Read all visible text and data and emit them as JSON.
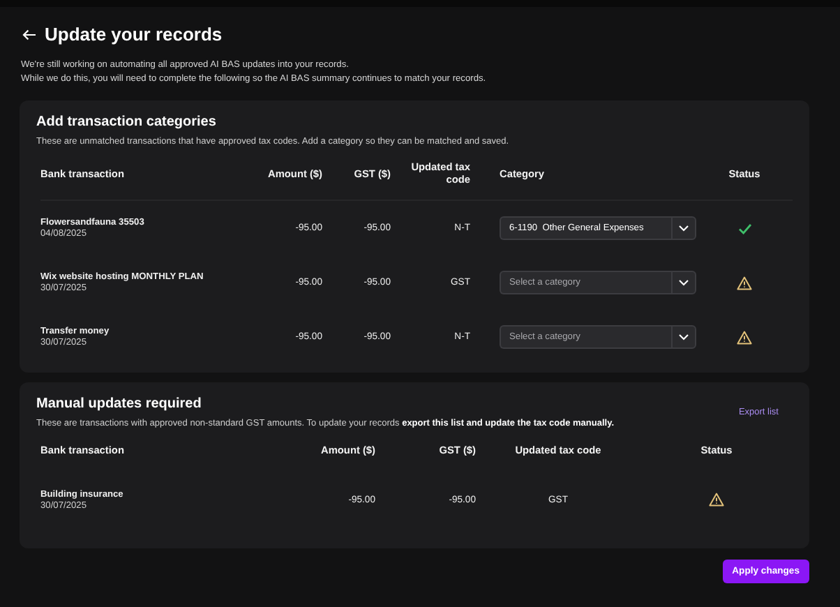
{
  "header": {
    "title": "Update your records",
    "intro": [
      "We're still working on automating all approved AI BAS updates into your records.",
      "While we do this, you will need to complete the following so the AI BAS summary continues to match your records."
    ]
  },
  "categories_section": {
    "title": "Add transaction categories",
    "description": "These are unmatched transactions that have approved tax codes. Add a category so they can be matched and saved.",
    "columns": [
      "Bank transaction",
      "Amount ($)",
      "GST ($)",
      "Updated tax code",
      "Category",
      "Status"
    ],
    "rows": [
      {
        "name": "Flowersandfauna 35503",
        "date": "04/08/2025",
        "amount": "-95.00",
        "gst": "-95.00",
        "tax_code": "N-T",
        "category": {
          "value": "6-1190  Other General Expenses"
        },
        "kind": "ok"
      },
      {
        "name": "Wix website hosting MONTHLY PLAN",
        "date": "30/07/2025",
        "amount": "-95.00",
        "gst": "-95.00",
        "tax_code": "GST",
        "category": {
          "placeholder": "Select a category"
        },
        "kind": "warning"
      },
      {
        "name": "Transfer money",
        "date": "30/07/2025",
        "amount": "-95.00",
        "gst": "-95.00",
        "tax_code": "N-T",
        "category": {
          "placeholder": "Select a category"
        },
        "kind": "warning"
      }
    ]
  },
  "manual_section": {
    "title": "Manual updates required",
    "description": "These are transactions with approved non-standard GST amounts. To update your records **export this list and update the tax code manually.**",
    "export_link": "Export list",
    "columns": [
      "Bank transaction",
      "Amount ($)",
      "GST ($)",
      "Updated tax code",
      "Status"
    ],
    "rows": [
      {
        "name": "Building insurance",
        "date": "30/07/2025",
        "amount": "-95.00",
        "gst": "-95.00",
        "tax_code": "GST",
        "kind": "warning"
      }
    ]
  },
  "apply_button": "Apply changes"
}
